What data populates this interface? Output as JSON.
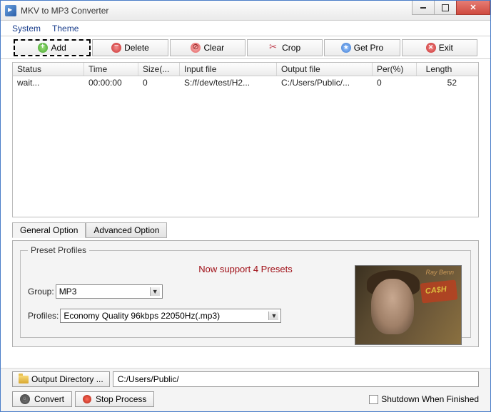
{
  "window": {
    "title": "MKV to MP3 Converter"
  },
  "menubar": {
    "system": "System",
    "theme": "Theme"
  },
  "toolbar": {
    "add": "Add",
    "delete": "Delete",
    "clear": "Clear",
    "crop": "Crop",
    "getpro": "Get Pro",
    "exit": "Exit"
  },
  "table": {
    "headers": {
      "status": "Status",
      "time": "Time",
      "size": "Size(...",
      "input": "Input file",
      "output": "Output file",
      "per": "Per(%)",
      "length": "Length"
    },
    "rows": [
      {
        "status": "wait...",
        "time": "00:00:00",
        "size": "0",
        "input": "S:/f/dev/test/H2...",
        "output": "C:/Users/Public/...",
        "per": "0",
        "length": "52"
      }
    ]
  },
  "tabs": {
    "general": "General Option",
    "advanced": "Advanced Option"
  },
  "preset": {
    "legend": "Preset Profiles",
    "support_msg": "Now support 4 Presets",
    "group_label": "Group:",
    "group_value": "MP3",
    "profiles_label": "Profiles:",
    "profiles_value": "Economy Quality 96kbps 22050Hz(.mp3)"
  },
  "output": {
    "button": "Output Directory ...",
    "path": "C:/Users/Public/"
  },
  "actions": {
    "convert": "Convert",
    "stop": "Stop Process",
    "shutdown": "Shutdown When Finished"
  }
}
